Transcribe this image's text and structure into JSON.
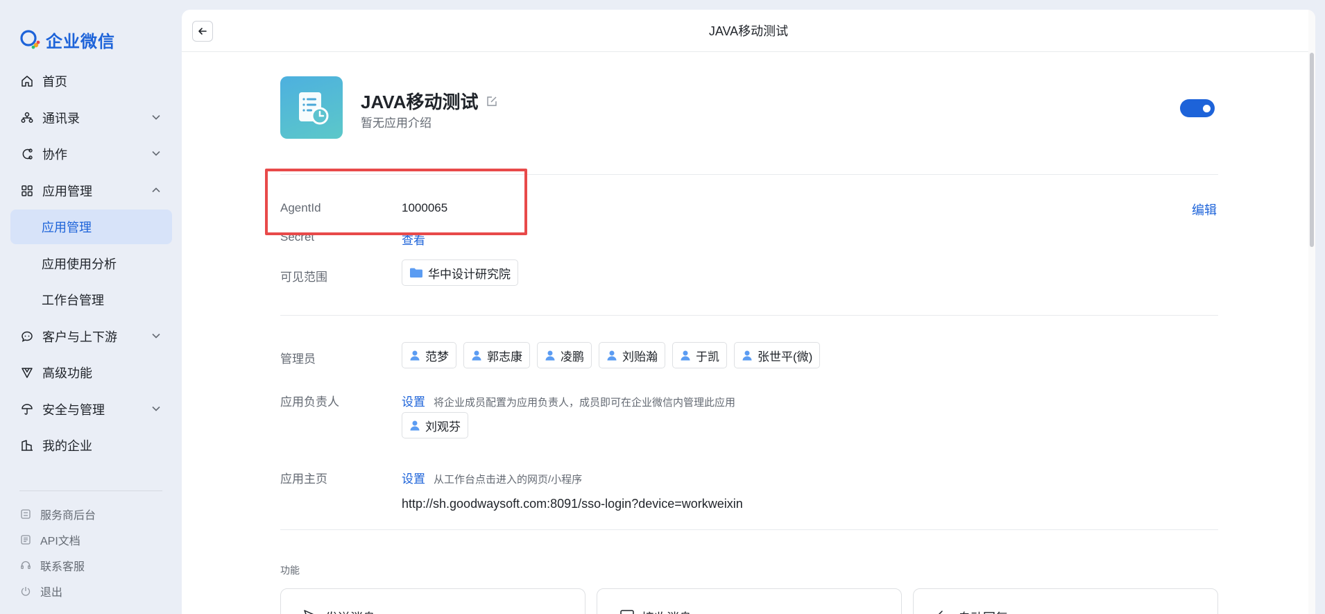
{
  "brand": {
    "name": "企业微信"
  },
  "nav": {
    "items": [
      {
        "label": "首页",
        "icon": "home-icon"
      },
      {
        "label": "通讯录",
        "icon": "contacts-icon"
      },
      {
        "label": "协作",
        "icon": "collab-icon"
      },
      {
        "label": "应用管理",
        "icon": "apps-icon"
      },
      {
        "label": "应用管理"
      },
      {
        "label": "应用使用分析"
      },
      {
        "label": "工作台管理"
      },
      {
        "label": "客户与上下游",
        "icon": "customer-icon"
      },
      {
        "label": "高级功能",
        "icon": "advanced-icon"
      },
      {
        "label": "安全与管理",
        "icon": "security-icon"
      },
      {
        "label": "我的企业",
        "icon": "company-icon"
      }
    ],
    "footer": [
      {
        "label": "服务商后台",
        "icon": "provider-icon"
      },
      {
        "label": "API文档",
        "icon": "api-icon"
      },
      {
        "label": "联系客服",
        "icon": "headset-icon"
      },
      {
        "label": "退出",
        "icon": "power-icon"
      }
    ]
  },
  "topbar": {
    "title": "JAVA移动测试"
  },
  "app": {
    "name": "JAVA移动测试",
    "description": "暂无应用介绍",
    "enabled": true
  },
  "details": {
    "agentid_label": "AgentId",
    "agentid_value": "1000065",
    "secret_label": "Secret",
    "secret_link": "查看",
    "edit_label": "编辑",
    "visibility_label": "可见范围",
    "visibility_value": "华中设计研究院",
    "admins_label": "管理员",
    "admins": [
      "范梦",
      "郭志康",
      "凌鹏",
      "刘贻瀚",
      "于凯",
      "张世平(微)"
    ],
    "owner_label": "应用负责人",
    "owner_set": "设置",
    "owner_hint": "将企业成员配置为应用负责人，成员即可在企业微信内管理此应用",
    "owner_value": "刘观芬",
    "homepage_label": "应用主页",
    "homepage_set": "设置",
    "homepage_hint": "从工作台点击进入的网页/小程序",
    "homepage_url": "http://sh.goodwaysoft.com:8091/sso-login?device=workweixin"
  },
  "features": {
    "title": "功能",
    "cards": [
      "发送消息",
      "接收消息",
      "自动回复"
    ]
  },
  "colors": {
    "accent": "#1d63d9",
    "highlight": "#e84a4a"
  }
}
